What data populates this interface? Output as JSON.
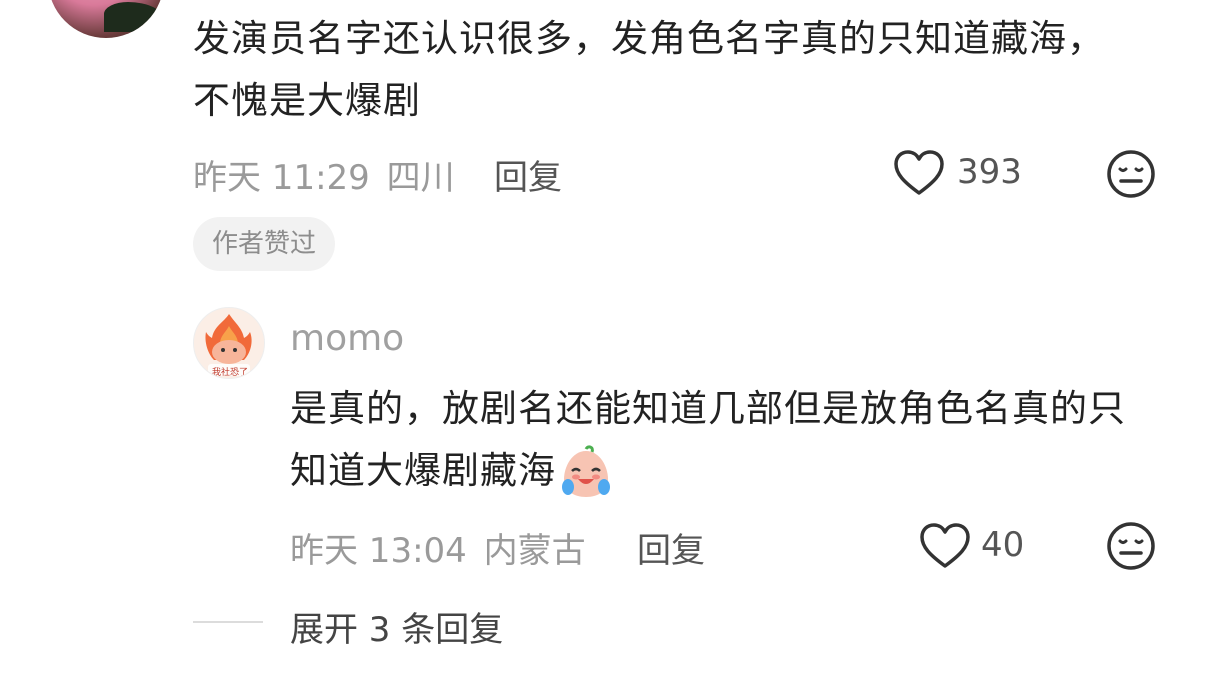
{
  "comment": {
    "text": "发演员名字还认识很多，发角色名字真的只知道藏海，不愧是大爆剧",
    "time": "昨天 11:29",
    "location": "四川",
    "reply_label": "回复",
    "like_count": "393",
    "author_liked_badge": "作者赞过"
  },
  "reply": {
    "username": "momo",
    "avatar_caption": "我社恐了",
    "text": "是真的，放剧名还能知道几部但是放角色名真的只知道大爆剧藏海",
    "time": "昨天 13:04",
    "location": "内蒙古",
    "reply_label": "回复",
    "like_count": "40"
  },
  "expand_label": "展开 3 条回复",
  "icons": {
    "like": "heart-outline-icon",
    "dislike": "meh-face-icon",
    "emoji": "crying-laughing-bun-emoji"
  }
}
